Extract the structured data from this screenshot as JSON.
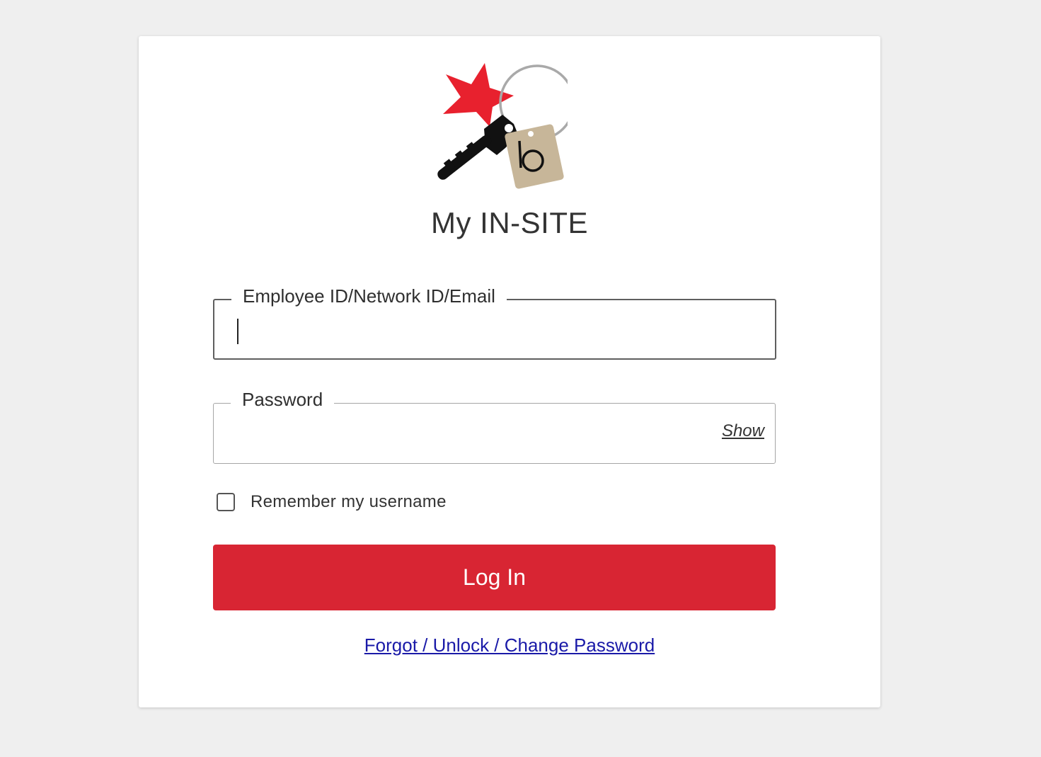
{
  "app": {
    "title": "My IN-SITE",
    "logo_icon": "star-key-tag-logo",
    "brand_red": "#d82533"
  },
  "form": {
    "username": {
      "label": "Employee ID/Network ID/Email",
      "value": "",
      "placeholder": ""
    },
    "password": {
      "label": "Password",
      "value": "",
      "show_label": "Show"
    },
    "remember": {
      "label": "Remember my username",
      "checked": false
    },
    "login_label": "Log In",
    "forgot_label": "Forgot / Unlock / Change Password"
  }
}
